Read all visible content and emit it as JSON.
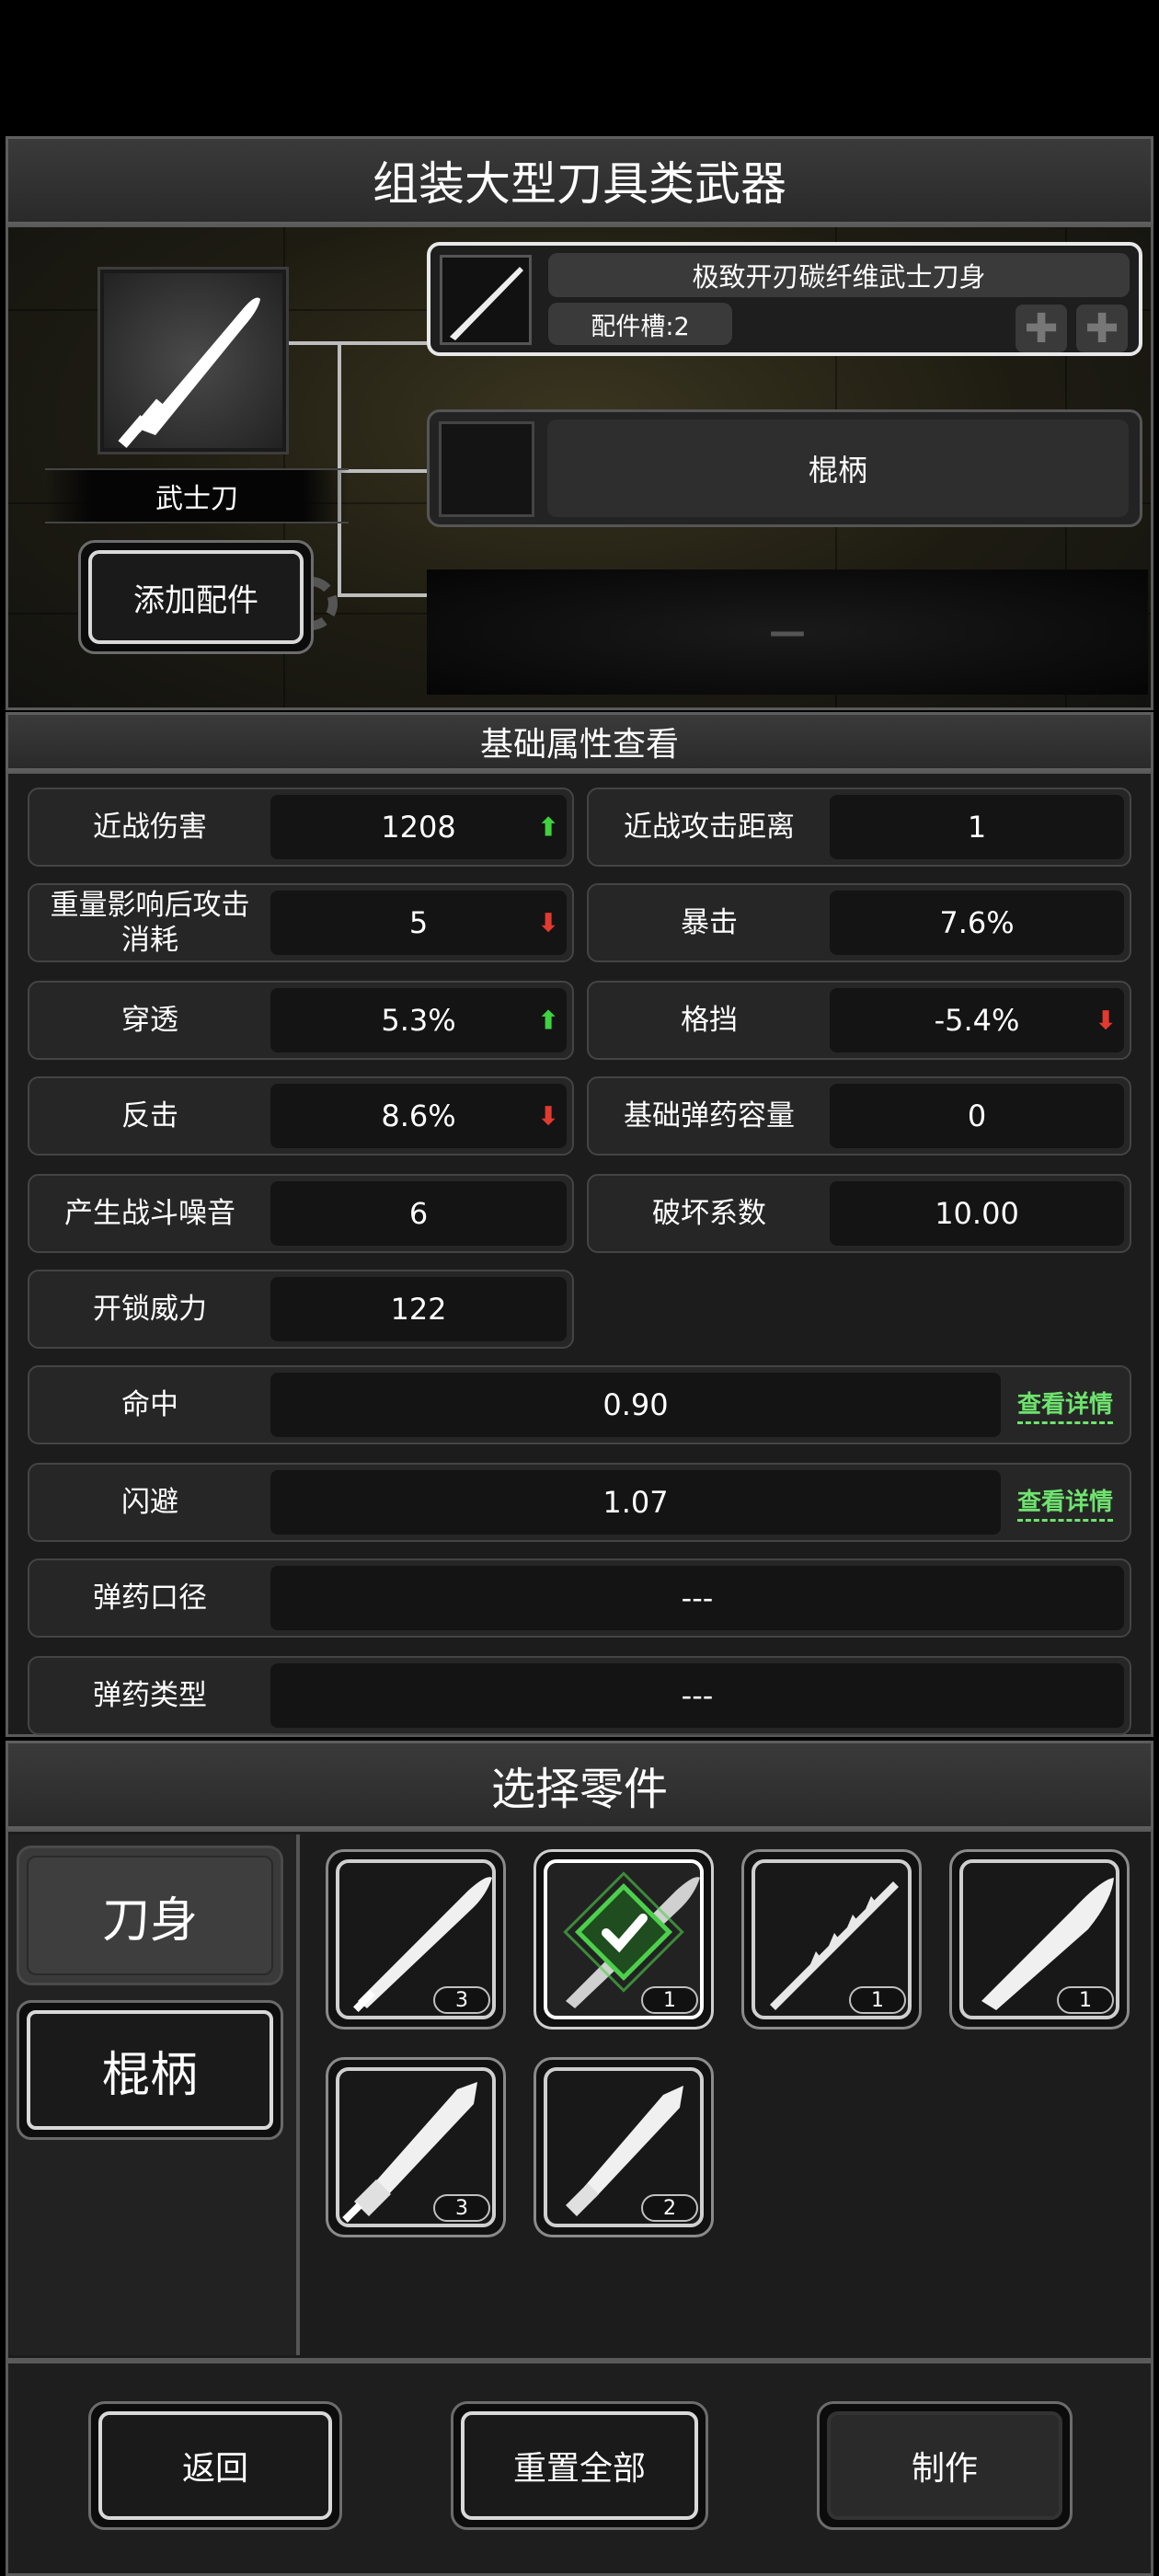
{
  "header": {
    "title": "组装大型刀具类武器"
  },
  "weapon": {
    "name": "武士刀",
    "add_part_label": "添加配件"
  },
  "slots": [
    {
      "name": "极致开刃碳纤维武士刀身",
      "sub": "配件槽:2",
      "state": "selected"
    },
    {
      "name": "棍柄",
      "state": "empty"
    },
    {
      "name": "—",
      "state": "locked"
    }
  ],
  "stats_section": {
    "title": "基础属性查看"
  },
  "stats": {
    "melee_damage": {
      "label": "近战伤害",
      "value": "1208",
      "trend": "up"
    },
    "melee_range": {
      "label": "近战攻击距离",
      "value": "1"
    },
    "stamina_cost": {
      "label": "重量影响后攻击消耗",
      "value": "5",
      "trend": "down"
    },
    "crit": {
      "label": "暴击",
      "value": "7.6%"
    },
    "penetration": {
      "label": "穿透",
      "value": "5.3%",
      "trend": "up"
    },
    "block": {
      "label": "格挡",
      "value": "-5.4%",
      "trend": "down"
    },
    "counter": {
      "label": "反击",
      "value": "8.6%",
      "trend": "down"
    },
    "ammo_capacity": {
      "label": "基础弹药容量",
      "value": "0"
    },
    "noise": {
      "label": "产生战斗噪音",
      "value": "6"
    },
    "destruction": {
      "label": "破坏系数",
      "value": "10.00"
    },
    "unlock_power": {
      "label": "开锁威力",
      "value": "122"
    },
    "accuracy": {
      "label": "命中",
      "value": "0.90",
      "link": "查看详情"
    },
    "evasion": {
      "label": "闪避",
      "value": "1.07",
      "link": "查看详情"
    },
    "caliber": {
      "label": "弹药口径",
      "value": "---"
    },
    "ammo_type": {
      "label": "弹药类型",
      "value": "---"
    }
  },
  "parts_section": {
    "title": "选择零件"
  },
  "categories": [
    {
      "label": "刀身",
      "active": true
    },
    {
      "label": "棍柄",
      "active": false
    }
  ],
  "parts": [
    {
      "icon": "katana-blade-icon",
      "count": "3",
      "selected": false
    },
    {
      "icon": "katana-blade-icon",
      "count": "1",
      "selected": true
    },
    {
      "icon": "serrated-blade-icon",
      "count": "1",
      "selected": false
    },
    {
      "icon": "curved-blade-icon",
      "count": "1",
      "selected": false
    },
    {
      "icon": "broad-sword-icon",
      "count": "3",
      "selected": false
    },
    {
      "icon": "broad-sword-icon",
      "count": "2",
      "selected": false
    }
  ],
  "footer": {
    "back_label": "返回",
    "reset_label": "重置全部",
    "craft_label": "制作"
  },
  "colors": {
    "increase": "#3fd33f",
    "decrease": "#e23a2f",
    "link": "#6ee36e",
    "selected_glow": "#4cd04c"
  }
}
